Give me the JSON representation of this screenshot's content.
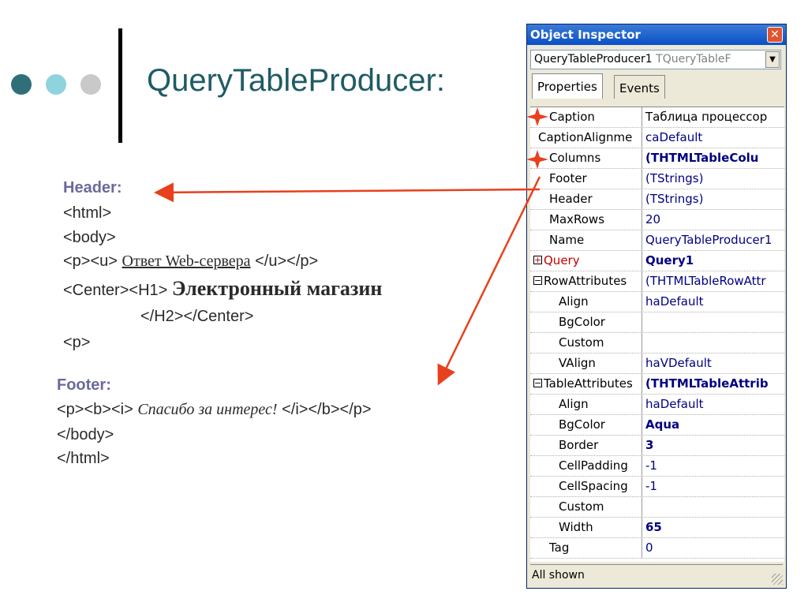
{
  "slide": {
    "title": "QueryTableProducer:",
    "bullets_colors": [
      "#2f6f77",
      "#8fd3dc",
      "#c9c9c9"
    ]
  },
  "header_block": {
    "label": "Header:",
    "lines": {
      "html_open": "<html>",
      "body_open": "<body>",
      "p_u_open": "<p><u>",
      "web_answer": "Ответ Web-сервера",
      "u_p_close": "</u></p>",
      "center_h1_open": "<Center><H1>",
      "shop": "Электронный магазин",
      "h2_center_close": "</H2></Center>",
      "p": "<p>"
    }
  },
  "footer_block": {
    "label": "Footer:",
    "lines": {
      "pbi_open": "<p><b><i>",
      "thanks": "Спасибо за интерес!",
      "ibp_close": "</i></b></p>",
      "body_close": "</body>",
      "html_close": "</html>"
    }
  },
  "inspector": {
    "title": "Object Inspector",
    "close_icon": "close-icon",
    "component_name": "QueryTableProducer1",
    "component_type": "TQueryTableF",
    "tabs": [
      "Properties",
      "Events"
    ],
    "status": "All shown",
    "rows": [
      {
        "name": "Caption",
        "value": "Таблица процессор"
      },
      {
        "name": "CaptionAlignme",
        "value": "caDefault"
      },
      {
        "name": "Columns",
        "value": "(THTMLTableColu"
      },
      {
        "name": "Footer",
        "value": "(TStrings)"
      },
      {
        "name": "Header",
        "value": "(TStrings)"
      },
      {
        "name": "MaxRows",
        "value": "20"
      },
      {
        "name": "Name",
        "value": "QueryTableProducer1"
      },
      {
        "name": "Query",
        "value": "Query1"
      },
      {
        "name": "RowAttributes",
        "value": "(THTMLTableRowAttr"
      },
      {
        "name": "Align",
        "value": "haDefault"
      },
      {
        "name": "BgColor",
        "value": ""
      },
      {
        "name": "Custom",
        "value": ""
      },
      {
        "name": "VAlign",
        "value": "haVDefault"
      },
      {
        "name": "TableAttributes",
        "value": "(THTMLTableAttrib"
      },
      {
        "name": "Align",
        "value": "haDefault"
      },
      {
        "name": "BgColor",
        "value": "Aqua"
      },
      {
        "name": "Border",
        "value": "3"
      },
      {
        "name": "CellPadding",
        "value": "-1"
      },
      {
        "name": "CellSpacing",
        "value": "-1"
      },
      {
        "name": "Custom",
        "value": ""
      },
      {
        "name": "Width",
        "value": "65"
      },
      {
        "name": "Tag",
        "value": "0"
      }
    ],
    "expander_plus": "+",
    "expander_minus": "−"
  },
  "colors": {
    "arrow": "#e8401c",
    "title_teal": "#1f5b66",
    "label_purple": "#6a6a9c"
  }
}
